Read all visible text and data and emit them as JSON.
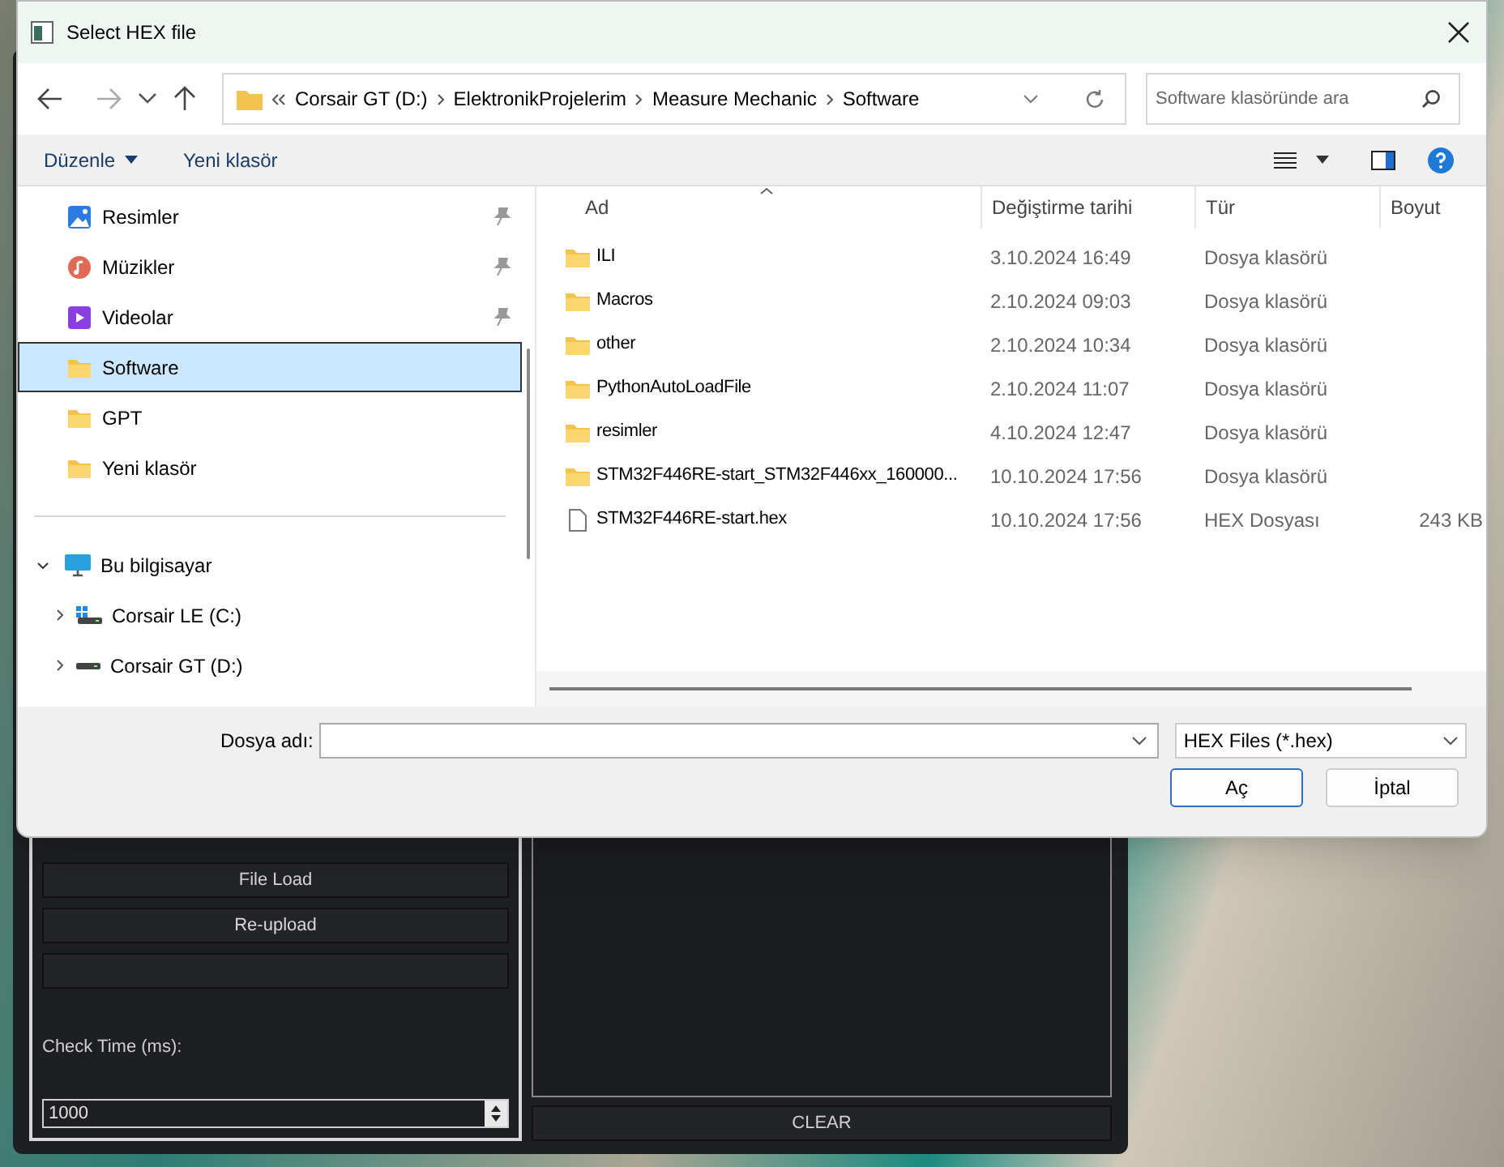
{
  "dialog": {
    "title": "Select HEX file",
    "address_path": [
      "Corsair GT (D:)",
      "ElektronikProjelerim",
      "Measure Mechanic",
      "Software"
    ],
    "search": {
      "placeholder": "Software klasöründe ara"
    },
    "toolbar": [
      {
        "label": "Düzenle",
        "has_menu": true
      },
      {
        "label": "Yeni klasör",
        "has_menu": false
      }
    ],
    "sidebar": {
      "quick_access": [
        {
          "label": "Resimler",
          "kind": "pictures",
          "pinned": true,
          "selected": false
        },
        {
          "label": "Müzikler",
          "kind": "music",
          "pinned": true,
          "selected": false
        },
        {
          "label": "Videolar",
          "kind": "videos",
          "pinned": true,
          "selected": false
        },
        {
          "label": "Software",
          "kind": "folder",
          "pinned": false,
          "selected": true
        },
        {
          "label": "GPT",
          "kind": "folder",
          "pinned": false,
          "selected": false
        },
        {
          "label": "Yeni klasör",
          "kind": "folder",
          "pinned": false,
          "selected": false
        }
      ],
      "this_pc": {
        "label": "Bu bilgisayar",
        "expanded": true,
        "children": [
          {
            "label": "Corsair LE (C:)",
            "kind": "system-drive",
            "expanded": false
          },
          {
            "label": "Corsair GT (D:)",
            "kind": "drive",
            "expanded": false
          }
        ]
      }
    },
    "file_list": {
      "columns": [
        "Ad",
        "Değiştirme tarihi",
        "Tür",
        "Boyut"
      ],
      "rows": [
        {
          "kind": "folder",
          "name": "ILI",
          "modified": "3.10.2024 16:49",
          "type": "Dosya klasörü"
        },
        {
          "kind": "folder",
          "name": "Macros",
          "modified": "2.10.2024 09:03",
          "type": "Dosya klasörü"
        },
        {
          "kind": "folder",
          "name": "other",
          "modified": "2.10.2024 10:34",
          "type": "Dosya klasörü"
        },
        {
          "kind": "folder",
          "name": "PythonAutoLoadFile",
          "modified": "2.10.2024 11:07",
          "type": "Dosya klasörü"
        },
        {
          "kind": "folder",
          "name": "resimler",
          "modified": "4.10.2024 12:47",
          "type": "Dosya klasörü"
        },
        {
          "kind": "folder",
          "name": "STM32F446RE-start_STM32F446xx_160000...",
          "modified": "10.10.2024 17:56",
          "type": "Dosya klasörü"
        },
        {
          "kind": "file",
          "name": "STM32F446RE-start.hex",
          "modified": "10.10.2024 17:56",
          "type": "HEX Dosyası",
          "size": "243 KB"
        }
      ]
    },
    "file_name": {
      "label": "Dosya adı:"
    },
    "filter": "HEX Files (*.hex)",
    "buttons": [
      "Aç",
      "İptal"
    ]
  },
  "app": {
    "buttons": [
      "File Load",
      "Re-upload"
    ],
    "check_time": {
      "label": "Check Time (ms):",
      "value": "1000"
    },
    "clear_button": "CLEAR"
  }
}
